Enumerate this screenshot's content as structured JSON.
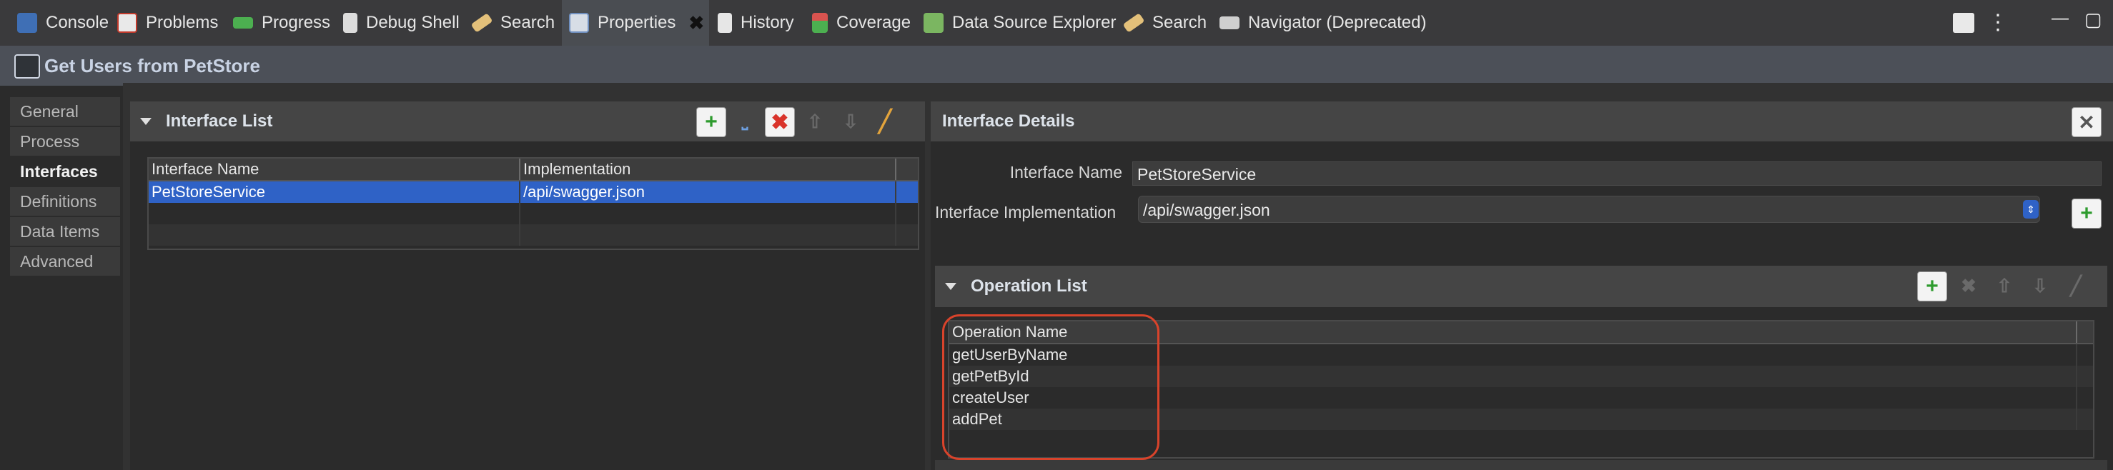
{
  "tabs": [
    {
      "label": "Console",
      "icon": "console-icon",
      "color": "#5b8fd6"
    },
    {
      "label": "Problems",
      "icon": "problems-icon",
      "color": "#c0392b"
    },
    {
      "label": "Progress",
      "icon": "progress-icon",
      "color": "#4caf50"
    },
    {
      "label": "Debug Shell",
      "icon": "debug-shell-icon",
      "color": "#c9c9c9"
    },
    {
      "label": "Search",
      "icon": "search-icon",
      "color": "#e3c07a"
    },
    {
      "label": "Properties",
      "icon": "properties-icon",
      "color": "#8fb3e6",
      "close": "✖"
    },
    {
      "label": "History",
      "icon": "history-icon",
      "color": "#c9c9c9"
    },
    {
      "label": "Coverage",
      "icon": "coverage-icon",
      "color": "#d9534f"
    },
    {
      "label": "Data Source Explorer",
      "icon": "data-source-explorer-icon",
      "color": "#7bb661"
    },
    {
      "label": "Search",
      "icon": "search-icon",
      "color": "#e3c07a"
    },
    {
      "label": "Navigator (Deprecated)",
      "icon": "navigator-icon",
      "color": "#c9c9c9"
    }
  ],
  "window_controls": {
    "menu": "⋮",
    "minimize": "—",
    "maximize": "▢"
  },
  "title": "Get Users from PetStore",
  "sidebar": {
    "items": [
      {
        "label": "General"
      },
      {
        "label": "Process"
      },
      {
        "label": "Interfaces"
      },
      {
        "label": "Definitions"
      },
      {
        "label": "Data Items"
      },
      {
        "label": "Advanced"
      }
    ],
    "active_index": 2
  },
  "interface_list": {
    "title": "Interface List",
    "columns": [
      "Interface Name",
      "Implementation"
    ],
    "rows": [
      {
        "name": "PetStoreService",
        "implementation": "/api/swagger.json",
        "selected": true
      }
    ]
  },
  "interface_details": {
    "title": "Interface Details",
    "name_label": "Interface Name",
    "name_value": "PetStoreService",
    "impl_label": "Interface Implementation",
    "impl_value": "/api/swagger.json"
  },
  "operation_list": {
    "title": "Operation List",
    "column": "Operation Name",
    "rows": [
      "getUserByName",
      "getPetById",
      "createUser",
      "addPet"
    ]
  },
  "colors": {
    "selection": "#2f62c6",
    "highlight_outline": "#d8432b",
    "add_green": "#2e9b2e",
    "delete_red": "#d9342b"
  }
}
